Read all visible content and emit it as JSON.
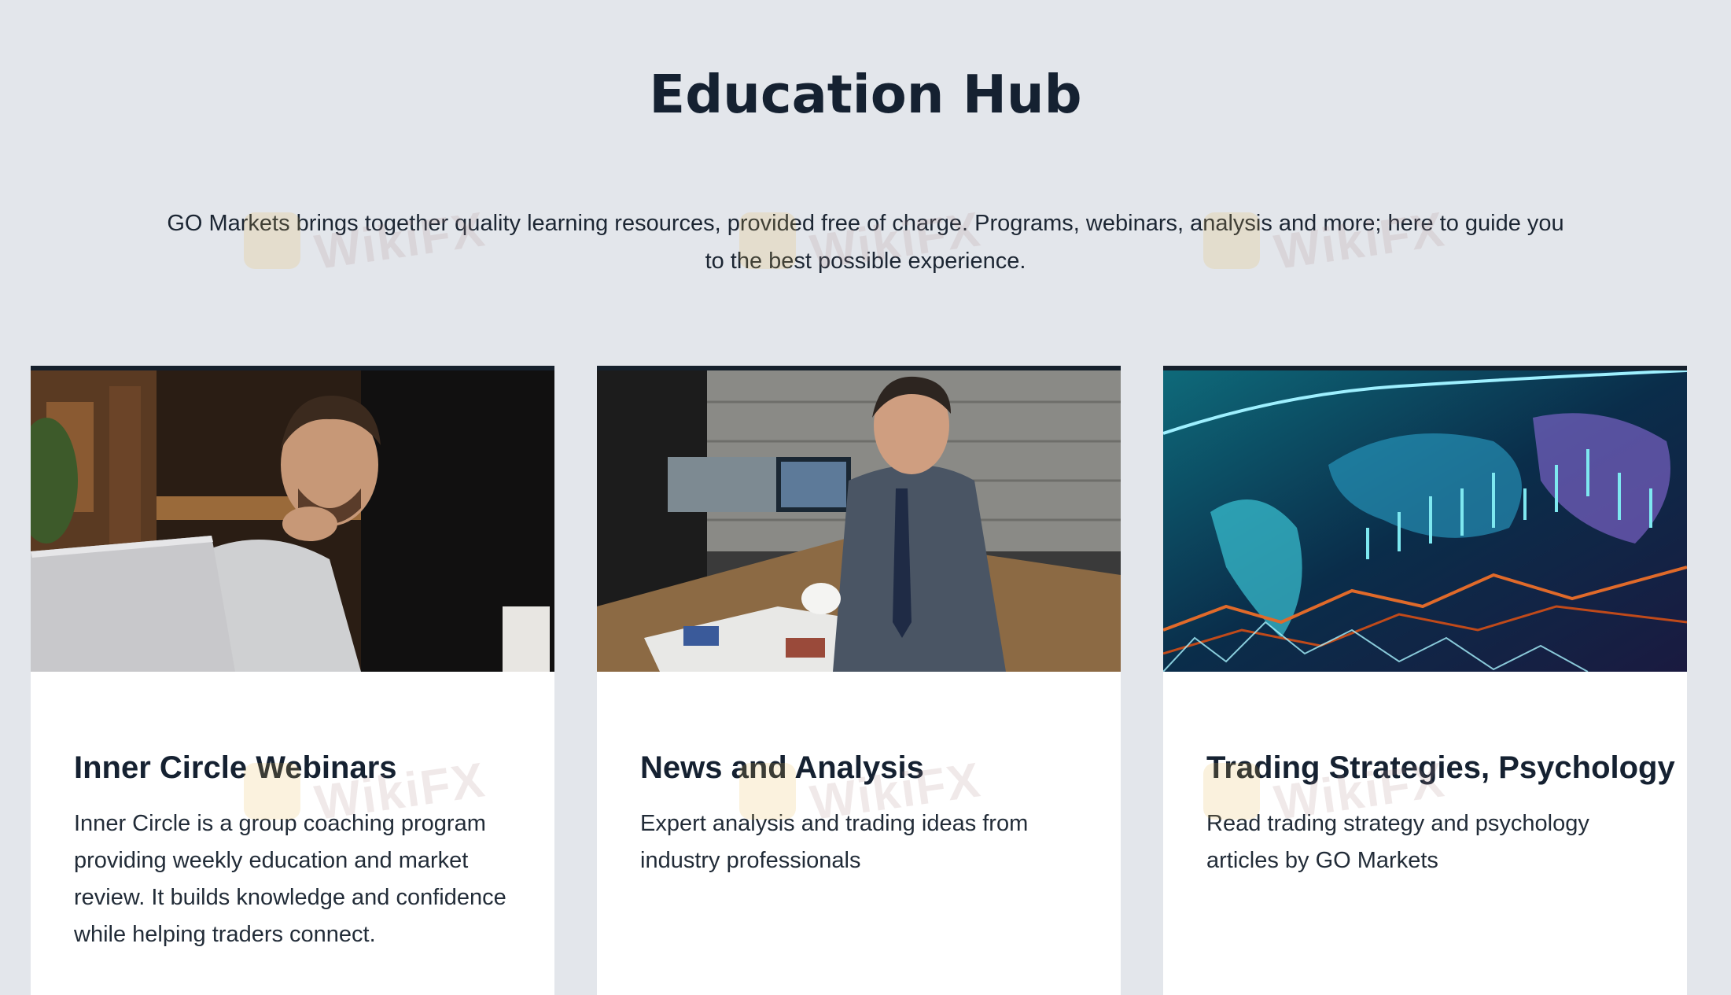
{
  "header": {
    "title": "Education Hub",
    "intro": "GO Markets brings together quality learning resources, provided free of charge. Programs, webinars, analysis and more; here to guide you to the best possible experience."
  },
  "cards": [
    {
      "title": "Inner Circle Webinars",
      "description": "Inner Circle is a group coaching program providing weekly education and market review. It builds knowledge and confidence while helping traders connect.",
      "image": "man-at-laptop-photo"
    },
    {
      "title": "News and Analysis",
      "description": "Expert analysis and trading ideas from industry professionals",
      "image": "man-reading-newspaper-photo"
    },
    {
      "title": "Trading Strategies, Psychology",
      "description": "Read trading strategy and psychology articles by GO Markets",
      "image": "world-map-trading-chart-photo"
    }
  ],
  "watermark": {
    "text": "WikiFX"
  },
  "colors": {
    "background": "#e3e6eb",
    "heading": "#152131",
    "card_background": "#ffffff",
    "card_border": "#16202c"
  }
}
